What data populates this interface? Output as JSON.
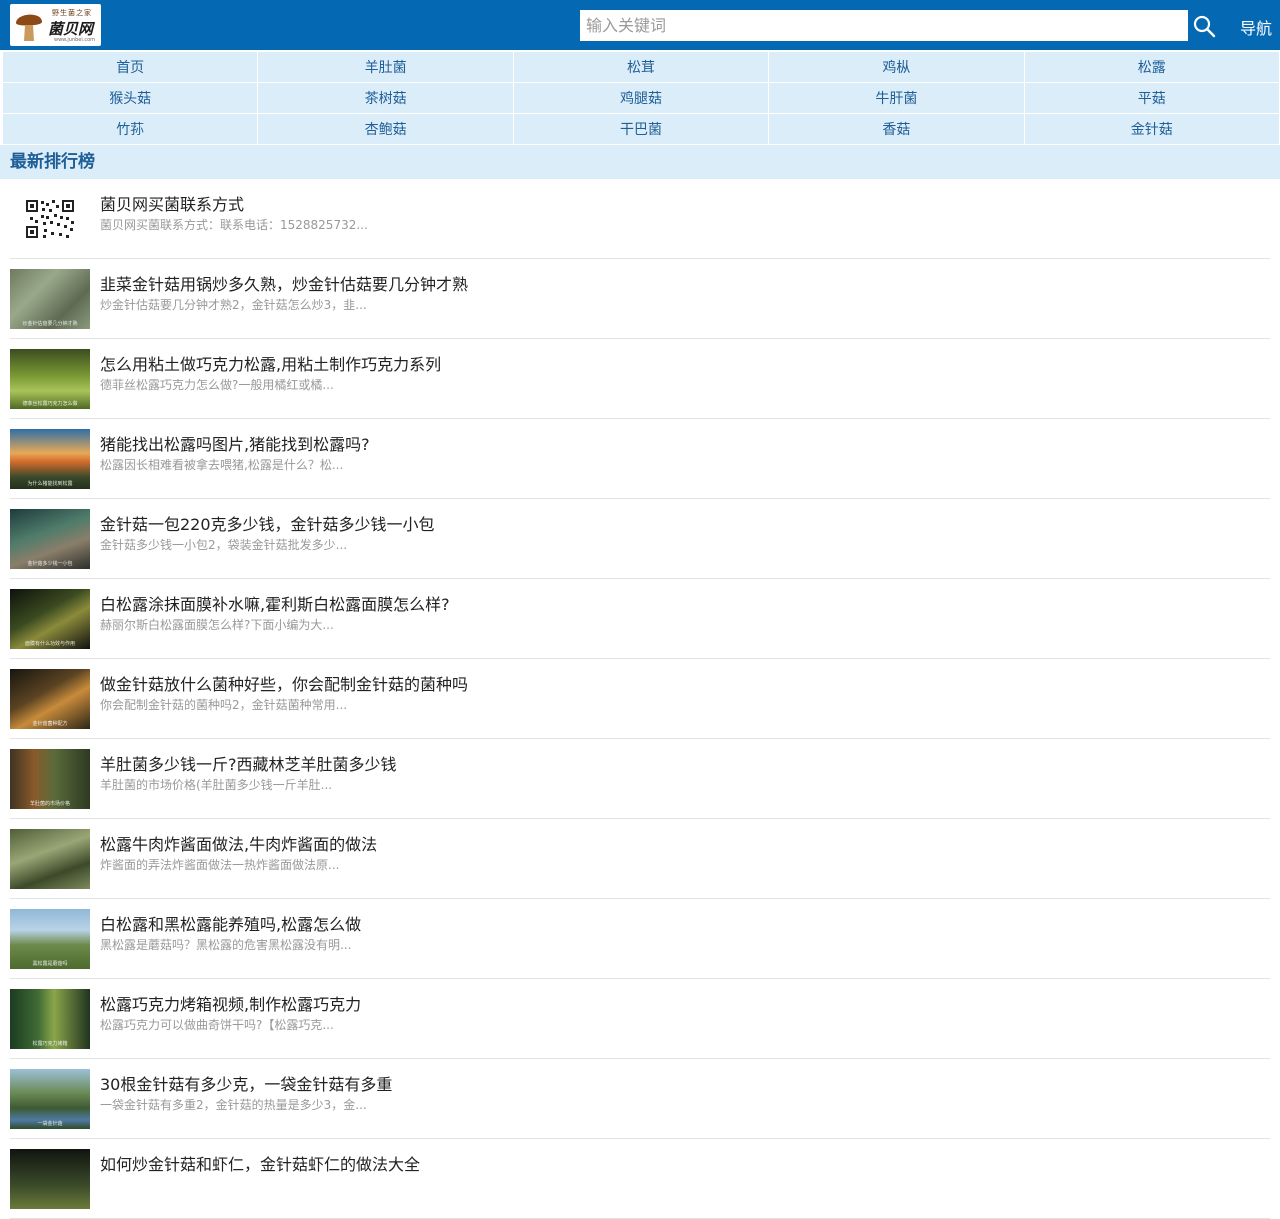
{
  "header": {
    "logo_tagline": "野生菌之家",
    "logo_name": "菌贝网",
    "logo_url": "www.junbei.com",
    "search_placeholder": "输入关键词",
    "nav_label": "导航"
  },
  "categories": [
    "首页",
    "羊肚菌",
    "松茸",
    "鸡枞",
    "松露",
    "猴头菇",
    "茶树菇",
    "鸡腿菇",
    "牛肝菌",
    "平菇",
    "竹荪",
    "杏鲍菇",
    "干巴菌",
    "香菇",
    "金针菇"
  ],
  "section_title": "最新排行榜",
  "articles": [
    {
      "title": "菌贝网买菌联系方式",
      "desc": "菌贝网买菌联系方式：联系电话：1528825732...",
      "thumb": "qr-code",
      "caption": ""
    },
    {
      "title": "韭菜金针菇用锅炒多久熟，炒金针估菇要几分钟才熟",
      "desc": "炒金针估菇要几分钟才熟2，金针菇怎么炒3，韭...",
      "thumb": "t1",
      "caption": "炒金针估菇要几分钟才熟"
    },
    {
      "title": "怎么用粘土做巧克力松露,用粘土制作巧克力系列",
      "desc": "德菲丝松露巧克力怎么做?一般用橘红或橘...",
      "thumb": "t2",
      "caption": "德菲丝松露巧克力怎么做"
    },
    {
      "title": "猪能找出松露吗图片,猪能找到松露吗?",
      "desc": "松露因长相难看被拿去喂猪,松露是什么？松...",
      "thumb": "t3",
      "caption": "为什么猪能找到松露"
    },
    {
      "title": "金针菇一包220克多少钱，金针菇多少钱一小包",
      "desc": "金针菇多少钱一小包2，袋装金针菇批发多少...",
      "thumb": "t4",
      "caption": "金针菇多少钱一小包"
    },
    {
      "title": "白松露涂抹面膜补水嘛,霍利斯白松露面膜怎么样?",
      "desc": "赫丽尔斯白松露面膜怎么样?下面小编为大...",
      "thumb": "t5",
      "caption": "面膜有什么功效与作用"
    },
    {
      "title": "做金针菇放什么菌种好些，你会配制金针菇的菌种吗",
      "desc": "你会配制金针菇的菌种吗2，金针菇菌种常用...",
      "thumb": "t6",
      "caption": "金针菇菌种配方"
    },
    {
      "title": "羊肚菌多少钱一斤?西藏林芝羊肚菌多少钱",
      "desc": "羊肚菌的市场价格(羊肚菌多少钱一斤羊肚...",
      "thumb": "t7",
      "caption": "羊肚菌的市场价格"
    },
    {
      "title": "松露牛肉炸酱面做法,牛肉炸酱面的做法",
      "desc": "炸酱面的弄法炸酱面做法一热炸酱面做法原...",
      "thumb": "t8",
      "caption": ""
    },
    {
      "title": "白松露和黑松露能养殖吗,松露怎么做",
      "desc": "黑松露是蘑菇吗？黑松露的危害黑松露没有明...",
      "thumb": "t9",
      "caption": "黑松露是蘑菇吗"
    },
    {
      "title": "松露巧克力烤箱视频,制作松露巧克力",
      "desc": "松露巧克力可以做曲奇饼干吗?【松露巧克...",
      "thumb": "t10",
      "caption": "松露巧克力烤箱"
    },
    {
      "title": "30根金针菇有多少克，一袋金针菇有多重",
      "desc": "一袋金针菇有多重2，金针菇的热量是多少3，金...",
      "thumb": "t11",
      "caption": "一袋金针菇"
    },
    {
      "title": "如何炒金针菇和虾仁，金针菇虾仁的做法大全",
      "desc": "",
      "thumb": "t12",
      "caption": ""
    }
  ],
  "colors": {
    "header_bg": "#0568b2",
    "cell_bg": "#dbedf9",
    "cell_text": "#1f5f97"
  }
}
